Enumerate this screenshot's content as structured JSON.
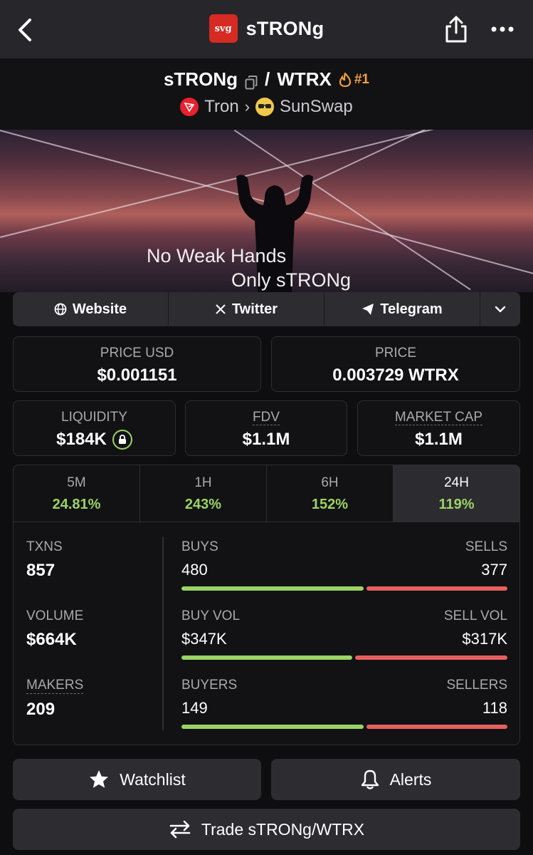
{
  "header": {
    "logo_text": "sᴠg",
    "app_name": "sTRONg",
    "back_icon": "chevron-left-icon",
    "share_icon": "share-icon",
    "more_icon": "more-dots-icon"
  },
  "pair": {
    "base": "sTRONg",
    "separator": "/",
    "quote": "WTRX",
    "rank": "#1",
    "chain": "Tron",
    "dex": "SunSwap"
  },
  "banner": {
    "line1": "No Weak Hands",
    "line2": "Only sTRONg"
  },
  "links": {
    "website": "Website",
    "twitter": "Twitter",
    "telegram": "Telegram"
  },
  "prices": {
    "price_usd_label": "PRICE USD",
    "price_usd": "$0.001151",
    "price_label": "PRICE",
    "price_native": "0.003729 WTRX"
  },
  "metrics": {
    "liquidity_label": "LIQUIDITY",
    "liquidity": "$184K",
    "fdv_label": "FDV",
    "fdv": "$1.1M",
    "mcap_label": "MARKET CAP",
    "mcap": "$1.1M"
  },
  "timeframes": [
    {
      "label": "5M",
      "change": "24.81%"
    },
    {
      "label": "1H",
      "change": "243%"
    },
    {
      "label": "6H",
      "change": "152%"
    },
    {
      "label": "24H",
      "change": "119%"
    }
  ],
  "active_timeframe": "24H",
  "stats": {
    "txns_label": "TXNS",
    "txns": "857",
    "volume_label": "VOLUME",
    "volume": "$664K",
    "makers_label": "MAKERS",
    "makers": "209",
    "buys_label": "BUYS",
    "buys": "480",
    "sells_label": "SELLS",
    "sells": "377",
    "buy_vol_label": "BUY VOL",
    "buy_vol": "$347K",
    "sell_vol_label": "SELL VOL",
    "sell_vol": "$317K",
    "buyers_label": "BUYERS",
    "buyers": "149",
    "sellers_label": "SELLERS",
    "sellers": "118",
    "buy_ratio_txns": 0.56,
    "buy_ratio_vol": 0.523,
    "buy_ratio_makers": 0.558
  },
  "actions": {
    "watchlist": "Watchlist",
    "alerts": "Alerts",
    "trade": "Trade sTRONg/WTRX"
  },
  "colors": {
    "positive": "#9bd365",
    "negative": "#e5605e",
    "rank": "#f5a03a",
    "background": "#0e0e11"
  }
}
